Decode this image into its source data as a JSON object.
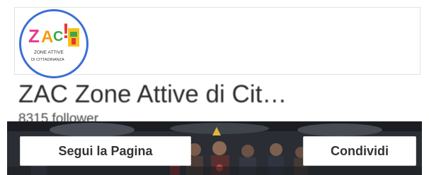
{
  "page": {
    "name": "ZAC Zone Attive di Cit…",
    "followers": "8315 follower"
  },
  "logo": {
    "title_letters": [
      "Z",
      "A",
      "C",
      "!"
    ],
    "subtitle_line1": "ZONE ATTIVE",
    "subtitle_line2": "DI CITTADINANZA"
  },
  "actions": {
    "follow_label": "Segui la Pagina",
    "share_label": "Condividi"
  },
  "colors": {
    "avatar_ring": "#3b6fd6",
    "logo_z": "#e63c8c",
    "logo_a": "#f39c12",
    "logo_c": "#3aa84a",
    "logo_bang": "#e53935",
    "logo_box": "#f6c21b"
  }
}
